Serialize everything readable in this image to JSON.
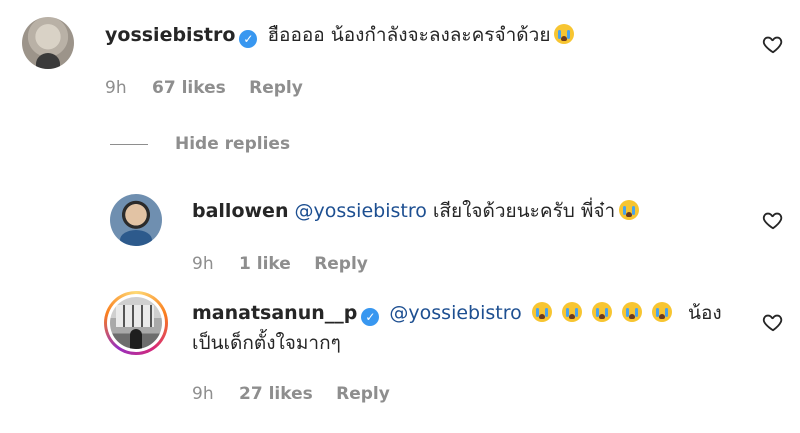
{
  "comments": [
    {
      "username": "yossiebistro",
      "verified": true,
      "text": "ฮืออออ น้องกำลังจะลงละครจำด้วย",
      "emoji": "crying-face",
      "time": "9h",
      "likes": "67 likes",
      "reply_label": "Reply"
    }
  ],
  "hide_replies_label": "Hide replies",
  "replies": [
    {
      "username": "ballowen",
      "verified": false,
      "mention": "@yossiebistro",
      "text": "เสียใจด้วยนะครับ  พี่จ๋า",
      "emoji": "crying-face",
      "time": "9h",
      "likes": "1 like",
      "reply_label": "Reply"
    },
    {
      "username": "manatsanun__p",
      "verified": true,
      "mention": "@yossiebistro",
      "text_line2_end": "น้อง",
      "text_line2": "เป็นเด็กตั้งใจมากๆ",
      "emoji": "crying-face",
      "emoji_count": 5,
      "time": "9h",
      "likes": "27 likes",
      "reply_label": "Reply"
    }
  ],
  "icons": {
    "like": "heart-icon",
    "verified": "verified-badge-icon",
    "emoji": "loudly-crying-face-emoji"
  }
}
